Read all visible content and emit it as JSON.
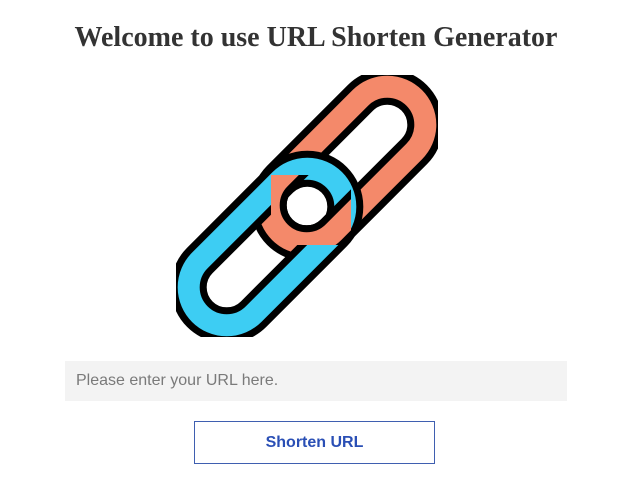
{
  "header": {
    "title": "Welcome to use URL Shorten Generator"
  },
  "logo": {
    "icon": "chain-link-icon",
    "colors": {
      "upper_link": "#f4896a",
      "lower_link": "#3dcdf3",
      "outline": "#000000"
    }
  },
  "form": {
    "url_input": {
      "value": "",
      "placeholder": "Please enter your URL here."
    },
    "submit_label": "Shorten URL"
  },
  "colors": {
    "button_text": "#2a4fb5",
    "button_border": "#3f5fb0",
    "input_background": "#f3f3f3"
  }
}
